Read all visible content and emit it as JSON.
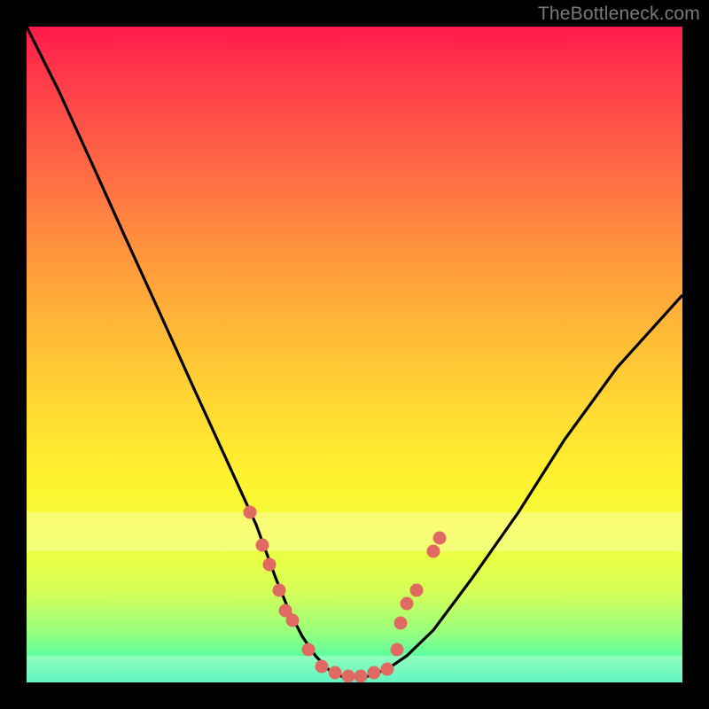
{
  "watermark": "TheBottleneck.com",
  "colors": {
    "frame": "#000000",
    "curve": "#000000",
    "marker": "#e06a62",
    "gradient_top": "#ff1a4b",
    "gradient_bottom": "#22f0a9"
  },
  "chart_data": {
    "type": "line",
    "title": "",
    "xlabel": "",
    "ylabel": "",
    "xlim": [
      0,
      100
    ],
    "ylim": [
      0,
      100
    ],
    "series": [
      {
        "name": "bottleneck-curve",
        "x": [
          0,
          5,
          10,
          15,
          20,
          25,
          30,
          35,
          38,
          40,
          42,
          44,
          46,
          48,
          50,
          52,
          55,
          58,
          62,
          68,
          75,
          82,
          90,
          100
        ],
        "y": [
          100,
          90,
          79,
          68,
          57,
          46,
          35,
          24,
          16,
          11,
          7,
          4,
          2,
          1,
          1,
          1,
          2,
          4,
          8,
          16,
          26,
          37,
          48,
          59
        ]
      }
    ],
    "markers": {
      "name": "highlight-points",
      "x": [
        34.0,
        36.0,
        37.0,
        38.5,
        39.5,
        40.5,
        43.0,
        45.0,
        47.0,
        49.0,
        51.0,
        53.0,
        55.0,
        56.5,
        57.0,
        58.0,
        59.5,
        62.0,
        63.0
      ],
      "y": [
        26.0,
        21.0,
        18.0,
        14.0,
        11.0,
        9.5,
        5.0,
        2.5,
        1.5,
        1.0,
        1.0,
        1.5,
        2.0,
        5.0,
        9.0,
        12.0,
        14.0,
        20.0,
        22.0
      ]
    },
    "pale_bands_y": [
      [
        20,
        26
      ],
      [
        0,
        4
      ]
    ]
  }
}
